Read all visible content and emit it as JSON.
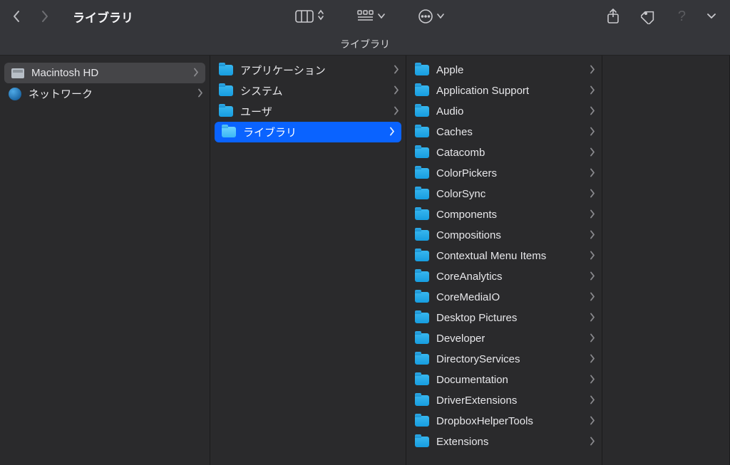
{
  "toolbar": {
    "title": "ライブラリ"
  },
  "pathbar": {
    "current": "ライブラリ"
  },
  "columns": [
    {
      "items": [
        {
          "label": "Macintosh HD",
          "icon": "disk",
          "selected": "gray",
          "has_children": true
        },
        {
          "label": "ネットワーク",
          "icon": "network",
          "selected": false,
          "has_children": true
        }
      ]
    },
    {
      "items": [
        {
          "label": "アプリケーション",
          "icon": "folder",
          "selected": false,
          "has_children": true
        },
        {
          "label": "システム",
          "icon": "folder",
          "selected": false,
          "has_children": true
        },
        {
          "label": "ユーザ",
          "icon": "folder",
          "selected": false,
          "has_children": true
        },
        {
          "label": "ライブラリ",
          "icon": "folder",
          "selected": "blue",
          "has_children": true
        }
      ]
    },
    {
      "items": [
        {
          "label": "Apple",
          "icon": "folder",
          "has_children": true
        },
        {
          "label": "Application Support",
          "icon": "folder",
          "has_children": true
        },
        {
          "label": "Audio",
          "icon": "folder",
          "has_children": true
        },
        {
          "label": "Caches",
          "icon": "folder",
          "has_children": true
        },
        {
          "label": "Catacomb",
          "icon": "folder",
          "has_children": true
        },
        {
          "label": "ColorPickers",
          "icon": "folder",
          "has_children": true
        },
        {
          "label": "ColorSync",
          "icon": "folder",
          "has_children": true
        },
        {
          "label": "Components",
          "icon": "folder",
          "has_children": true
        },
        {
          "label": "Compositions",
          "icon": "folder",
          "has_children": true
        },
        {
          "label": "Contextual Menu Items",
          "icon": "folder",
          "has_children": true
        },
        {
          "label": "CoreAnalytics",
          "icon": "folder",
          "has_children": true
        },
        {
          "label": "CoreMediaIO",
          "icon": "folder",
          "has_children": true
        },
        {
          "label": "Desktop Pictures",
          "icon": "folder",
          "has_children": true
        },
        {
          "label": "Developer",
          "icon": "folder",
          "has_children": true
        },
        {
          "label": "DirectoryServices",
          "icon": "folder",
          "has_children": true
        },
        {
          "label": "Documentation",
          "icon": "folder",
          "has_children": true
        },
        {
          "label": "DriverExtensions",
          "icon": "folder",
          "has_children": true
        },
        {
          "label": "DropboxHelperTools",
          "icon": "folder",
          "has_children": true
        },
        {
          "label": "Extensions",
          "icon": "folder",
          "has_children": true
        }
      ]
    },
    {
      "items": []
    }
  ]
}
